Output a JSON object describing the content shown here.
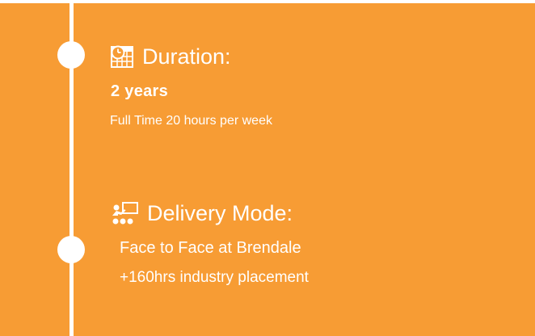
{
  "colors": {
    "background": "#f79c34",
    "foreground": "#ffffff"
  },
  "duration": {
    "icon": "calendar-clock-icon",
    "heading": "Duration:",
    "value": "2 years",
    "detail": "Full Time 20 hours per week"
  },
  "delivery": {
    "icon": "classroom-icon",
    "heading": "Delivery Mode:",
    "value": "Face to Face at Brendale",
    "detail": "+160hrs industry placement"
  }
}
